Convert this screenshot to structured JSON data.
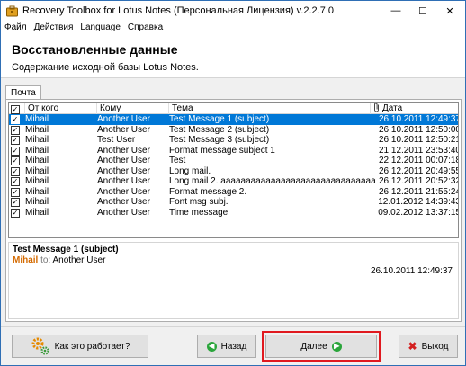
{
  "window": {
    "title": "Recovery Toolbox for Lotus Notes (Персональная Лицензия) v.2.2.7.0",
    "min_glyph": "—",
    "max_glyph": "☐",
    "close_glyph": "✕"
  },
  "menu": [
    "Файл",
    "Действия",
    "Language",
    "Справка"
  ],
  "header": {
    "title": "Восстановленные данные",
    "subtitle": "Содержание исходной базы Lotus Notes."
  },
  "tab": {
    "label": "Почта"
  },
  "columns": {
    "from": "От кого",
    "to": "Кому",
    "subject": "Тема",
    "date": "Дата"
  },
  "rows": [
    {
      "from": "Mihail",
      "to": "Another User",
      "subject": "Test Message 1 (subject)",
      "date": "26.10.2011 12:49:37",
      "checked": true,
      "selected": true
    },
    {
      "from": "Mihail",
      "to": "Another User",
      "subject": "Test Message 2 (subject)",
      "date": "26.10.2011 12:50:00",
      "checked": true,
      "selected": false
    },
    {
      "from": "Mihail",
      "to": "Test User",
      "subject": "Test Message 3 (subject)",
      "date": "26.10.2011 12:50:21",
      "checked": true,
      "selected": false
    },
    {
      "from": "Mihail",
      "to": "Another User",
      "subject": "Format message subject 1",
      "date": "21.12.2011 23:53:40",
      "checked": true,
      "selected": false
    },
    {
      "from": "Mihail",
      "to": "Another User",
      "subject": "Test",
      "date": "22.12.2011 00:07:18",
      "checked": true,
      "selected": false
    },
    {
      "from": "Mihail",
      "to": "Another User",
      "subject": "Long mail.",
      "date": "26.12.2011 20:49:55",
      "checked": true,
      "selected": false
    },
    {
      "from": "Mihail",
      "to": "Another User",
      "subject": "Long mail 2. aaaaaaaaaaaaaaaaaaaaaaaaaaaaaaaa",
      "date": "26.12.2011 20:52:32",
      "checked": true,
      "selected": false
    },
    {
      "from": "Mihail",
      "to": "Another User",
      "subject": "Format message 2.",
      "date": "26.12.2011 21:55:24",
      "checked": true,
      "selected": false
    },
    {
      "from": "Mihail",
      "to": "Another User",
      "subject": "Font msg subj.",
      "date": "12.01.2012 14:39:43",
      "checked": true,
      "selected": false
    },
    {
      "from": "Mihail",
      "to": "Another User",
      "subject": "Time message",
      "date": "09.02.2012 13:37:15",
      "checked": true,
      "selected": false
    }
  ],
  "preview": {
    "subject": "Test Message 1 (subject)",
    "from": "Mihail",
    "to_label": "to:",
    "to": "Another User",
    "date": "26.10.2011 12:49:37"
  },
  "buttons": {
    "how": "Как это работает?",
    "back": "Назад",
    "next": "Далее",
    "exit": "Выход"
  },
  "icons": {
    "app": "toolbox-icon",
    "gear": "gear-icon",
    "back": "arrow-left-icon",
    "next": "arrow-right-icon",
    "exit": "close-x-icon",
    "attachment": "paperclip-icon"
  },
  "colors": {
    "selection": "#0078d7",
    "highlight_frame": "#e0191f",
    "sender": "#d46a00",
    "exit_red": "#d32020",
    "nav_green": "#2aa53b"
  }
}
